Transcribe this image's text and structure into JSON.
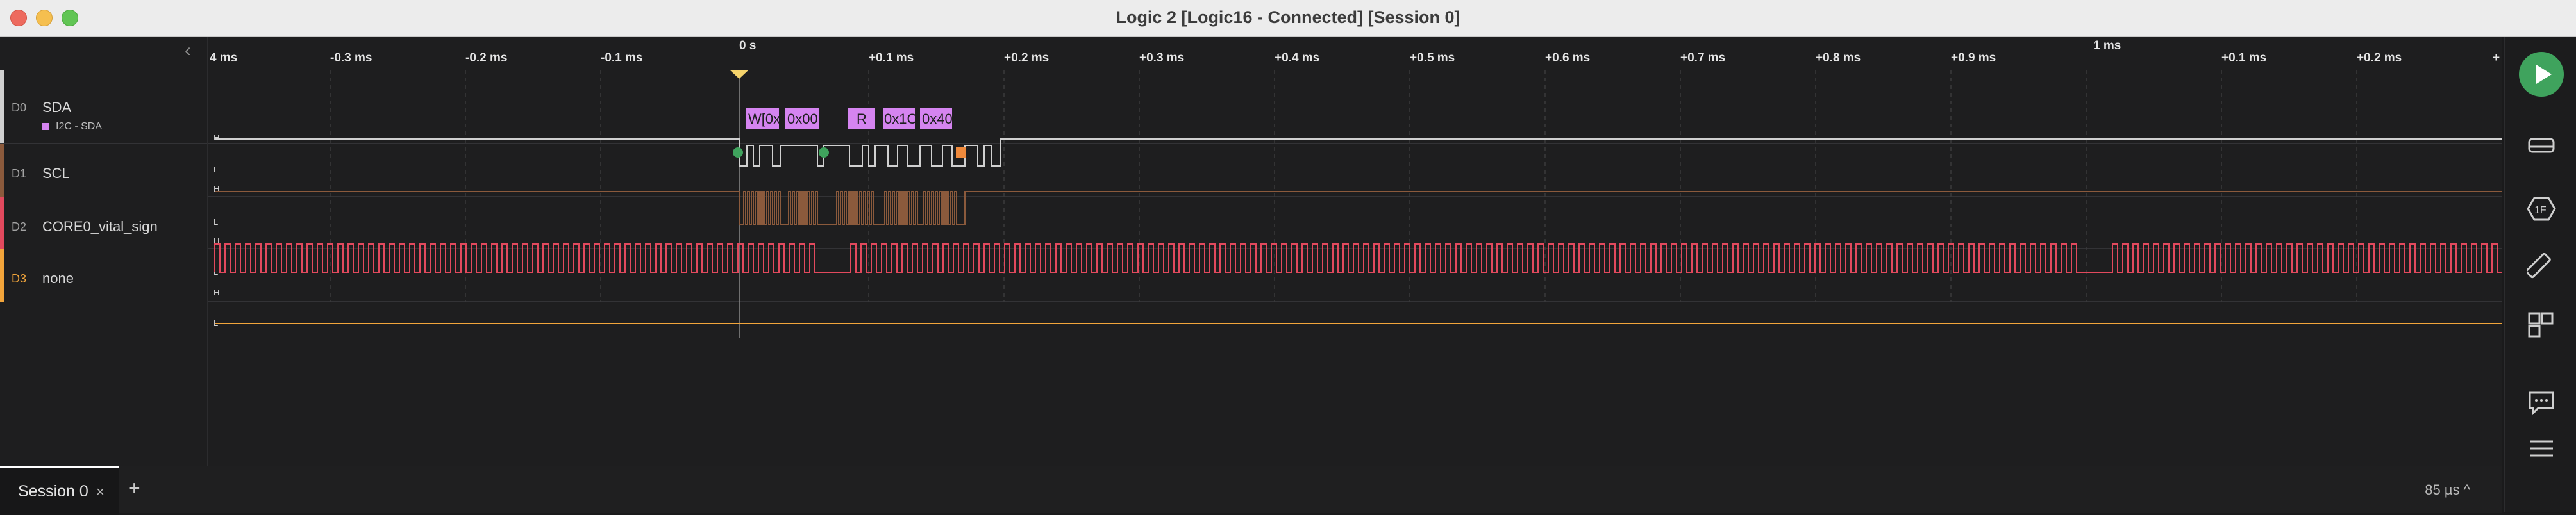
{
  "window": {
    "title": "Logic 2 [Logic16 - Connected] [Session 0]"
  },
  "timeline": {
    "ticks": [
      "4 ms",
      "-0.3 ms",
      "-0.2 ms",
      "-0.1 ms",
      "0 s",
      "+0.1 ms",
      "+0.2 ms",
      "+0.3 ms",
      "+0.4 ms",
      "+0.5 ms",
      "+0.6 ms",
      "+0.7 ms",
      "+0.8 ms",
      "+0.9 ms",
      "1 ms",
      "+0.1 ms",
      "+0.2 ms",
      "+"
    ],
    "trigger_label": "T"
  },
  "channels": [
    {
      "id": "D0",
      "name": "SDA",
      "color": "#d0d0d0",
      "analyzer": "I2C - SDA",
      "high": "H",
      "low": "L"
    },
    {
      "id": "D1",
      "name": "SCL",
      "color": "#8b5a3c",
      "high": "H",
      "low": "L"
    },
    {
      "id": "D2",
      "name": "CORE0_vital_sign",
      "color": "#e2495d",
      "high": "H",
      "low": "L"
    },
    {
      "id": "D3",
      "name": "none",
      "color": "#f2a53b",
      "high": "H",
      "low": "L"
    }
  ],
  "i2c_frames": [
    "W[0x",
    "0x00",
    "R",
    "0x1C",
    "0x40"
  ],
  "colors": {
    "accent": "#3fa35d",
    "analyzer": "#d584f0"
  },
  "bottom": {
    "tab": "Session 0",
    "close": "×",
    "add": "+",
    "zoom": "85 µs ^"
  },
  "icons": [
    "play-icon",
    "hardware-icon",
    "protocol-icon",
    "measure-icon",
    "extensions-icon",
    "comment-icon",
    "menu-icon"
  ]
}
